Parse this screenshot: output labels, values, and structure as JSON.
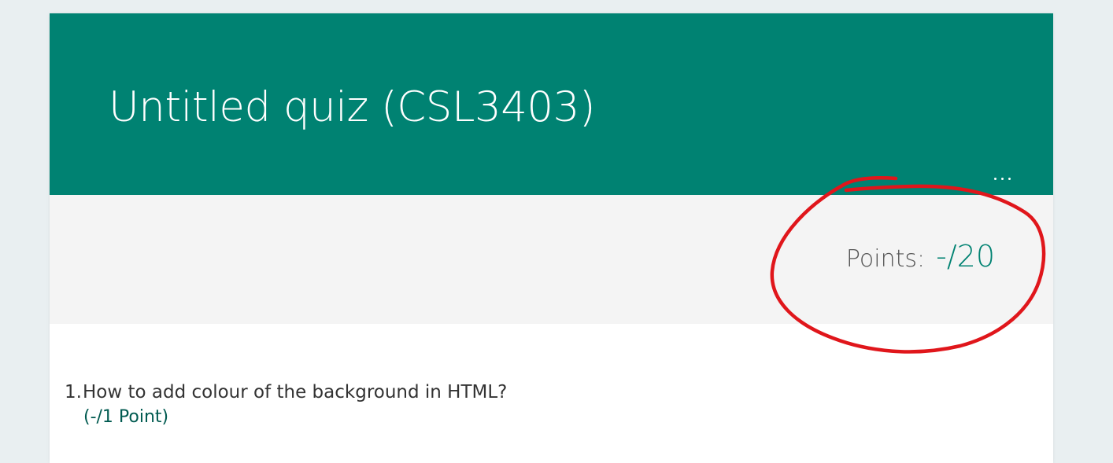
{
  "quiz": {
    "title": "Untitled quiz (CSL3403)",
    "more_icon": "ellipsis-icon"
  },
  "points": {
    "label": "Points:",
    "value": "-/20"
  },
  "questions": [
    {
      "number": "1.",
      "text": "How to add colour of the background in HTML?",
      "points": "(-/1 Point)"
    }
  ],
  "colors": {
    "header": "#008272",
    "accent": "#008272",
    "annotation": "#e0161b",
    "background": "#e9eff1"
  }
}
